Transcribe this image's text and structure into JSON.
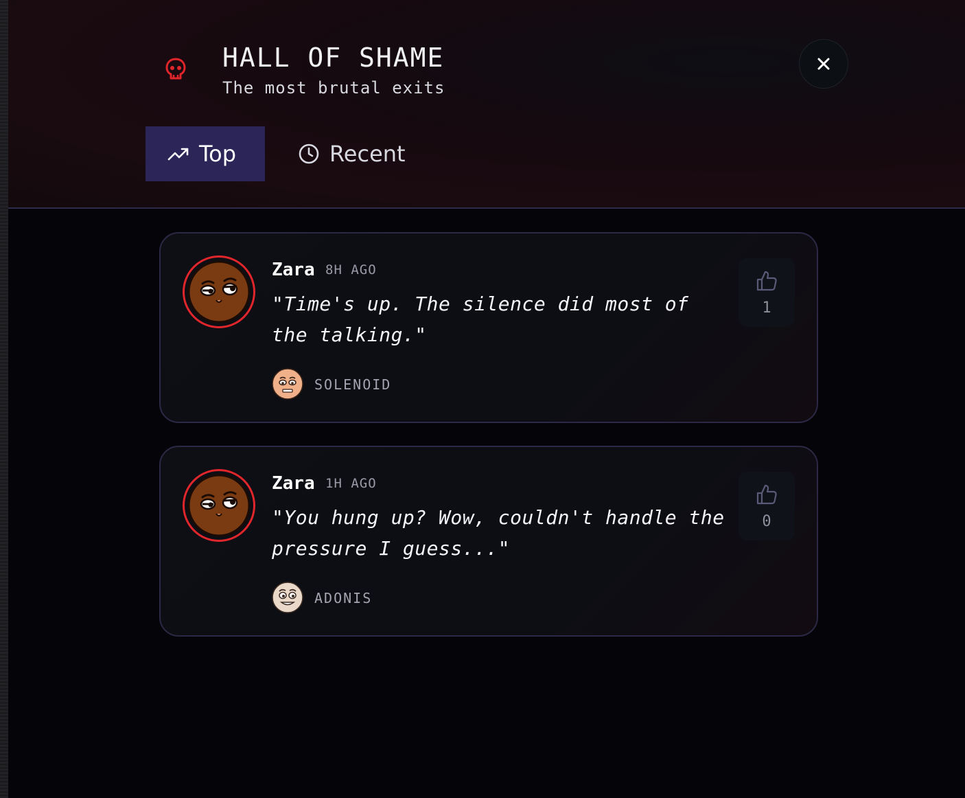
{
  "header": {
    "title": "HALL OF SHAME",
    "subtitle": "The most brutal exits",
    "icon": "skull-icon",
    "close_icon": "close-icon",
    "accent_color": "#e0262b"
  },
  "tabs": [
    {
      "label": "Top",
      "icon": "trending-up-icon",
      "active": true
    },
    {
      "label": "Recent",
      "icon": "clock-icon",
      "active": false
    }
  ],
  "entries": [
    {
      "name": "Zara",
      "time": "8H AGO",
      "quote": "\"Time's up. The silence did most of the talking.\"",
      "agent": "SOLENOID",
      "likes": "1"
    },
    {
      "name": "Zara",
      "time": "1H AGO",
      "quote": "\"You hung up? Wow, couldn't handle the pressure I guess...\"",
      "agent": "ADONIS",
      "likes": "0"
    }
  ]
}
